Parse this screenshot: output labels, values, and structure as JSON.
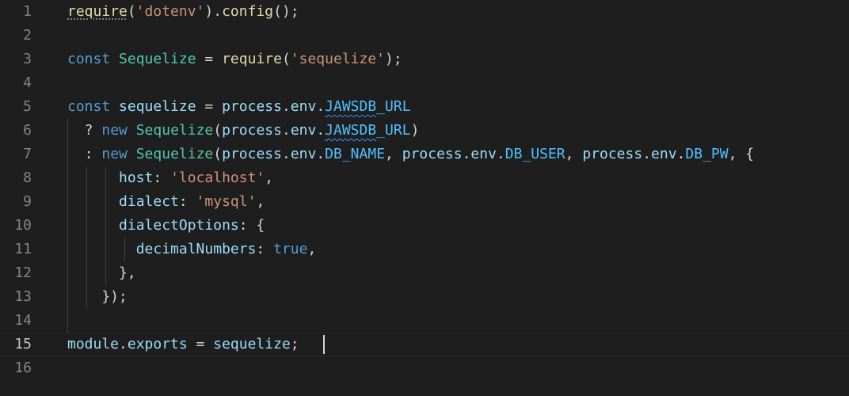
{
  "editor": {
    "lines": [
      {
        "number": "1",
        "tokens": [
          {
            "t": "require",
            "c": "fn",
            "deco": "dotted"
          },
          {
            "t": "(",
            "c": "plain"
          },
          {
            "t": "'dotenv'",
            "c": "str"
          },
          {
            "t": ").",
            "c": "plain"
          },
          {
            "t": "config",
            "c": "fn"
          },
          {
            "t": "();",
            "c": "plain"
          }
        ]
      },
      {
        "number": "2",
        "tokens": []
      },
      {
        "number": "3",
        "tokens": [
          {
            "t": "const ",
            "c": "kw"
          },
          {
            "t": "Sequelize",
            "c": "cls"
          },
          {
            "t": " = ",
            "c": "plain"
          },
          {
            "t": "require",
            "c": "fn"
          },
          {
            "t": "(",
            "c": "plain"
          },
          {
            "t": "'sequelize'",
            "c": "str"
          },
          {
            "t": ");",
            "c": "plain"
          }
        ]
      },
      {
        "number": "4",
        "tokens": []
      },
      {
        "number": "5",
        "tokens": [
          {
            "t": "const ",
            "c": "kw"
          },
          {
            "t": "sequelize",
            "c": "var"
          },
          {
            "t": " = ",
            "c": "plain"
          },
          {
            "t": "process",
            "c": "var"
          },
          {
            "t": ".",
            "c": "plain"
          },
          {
            "t": "env",
            "c": "var"
          },
          {
            "t": ".",
            "c": "plain"
          },
          {
            "t": "JAWSDB",
            "c": "const",
            "deco": "squiggle"
          },
          {
            "t": "_URL",
            "c": "const"
          }
        ]
      },
      {
        "number": "6",
        "tokens": [
          {
            "t": "  ? ",
            "c": "plain"
          },
          {
            "t": "new ",
            "c": "kw"
          },
          {
            "t": "Sequelize",
            "c": "cls"
          },
          {
            "t": "(",
            "c": "plain"
          },
          {
            "t": "process",
            "c": "var"
          },
          {
            "t": ".",
            "c": "plain"
          },
          {
            "t": "env",
            "c": "var"
          },
          {
            "t": ".",
            "c": "plain"
          },
          {
            "t": "JAWSDB",
            "c": "const",
            "deco": "squiggle"
          },
          {
            "t": "_URL",
            "c": "const"
          },
          {
            "t": ")",
            "c": "plain"
          }
        ]
      },
      {
        "number": "7",
        "tokens": [
          {
            "t": "  : ",
            "c": "plain"
          },
          {
            "t": "new ",
            "c": "kw"
          },
          {
            "t": "Sequelize",
            "c": "cls"
          },
          {
            "t": "(",
            "c": "plain"
          },
          {
            "t": "process",
            "c": "var"
          },
          {
            "t": ".",
            "c": "plain"
          },
          {
            "t": "env",
            "c": "var"
          },
          {
            "t": ".",
            "c": "plain"
          },
          {
            "t": "DB_NAME",
            "c": "const"
          },
          {
            "t": ", ",
            "c": "plain"
          },
          {
            "t": "process",
            "c": "var"
          },
          {
            "t": ".",
            "c": "plain"
          },
          {
            "t": "env",
            "c": "var"
          },
          {
            "t": ".",
            "c": "plain"
          },
          {
            "t": "DB_USER",
            "c": "const"
          },
          {
            "t": ", ",
            "c": "plain"
          },
          {
            "t": "process",
            "c": "var"
          },
          {
            "t": ".",
            "c": "plain"
          },
          {
            "t": "env",
            "c": "var"
          },
          {
            "t": ".",
            "c": "plain"
          },
          {
            "t": "DB_PW",
            "c": "const"
          },
          {
            "t": ", {",
            "c": "plain"
          }
        ]
      },
      {
        "number": "8",
        "tokens": [
          {
            "t": "      ",
            "c": "plain"
          },
          {
            "t": "host",
            "c": "var"
          },
          {
            "t": ": ",
            "c": "plain"
          },
          {
            "t": "'localhost'",
            "c": "str"
          },
          {
            "t": ",",
            "c": "plain"
          }
        ]
      },
      {
        "number": "9",
        "tokens": [
          {
            "t": "      ",
            "c": "plain"
          },
          {
            "t": "dialect",
            "c": "var"
          },
          {
            "t": ": ",
            "c": "plain"
          },
          {
            "t": "'mysql'",
            "c": "str"
          },
          {
            "t": ",",
            "c": "plain"
          }
        ]
      },
      {
        "number": "10",
        "tokens": [
          {
            "t": "      ",
            "c": "plain"
          },
          {
            "t": "dialectOptions",
            "c": "var"
          },
          {
            "t": ": {",
            "c": "plain"
          }
        ]
      },
      {
        "number": "11",
        "tokens": [
          {
            "t": "        ",
            "c": "plain"
          },
          {
            "t": "decimalNumbers",
            "c": "var"
          },
          {
            "t": ": ",
            "c": "plain"
          },
          {
            "t": "true",
            "c": "kw"
          },
          {
            "t": ",",
            "c": "plain"
          }
        ]
      },
      {
        "number": "12",
        "tokens": [
          {
            "t": "      },",
            "c": "plain"
          }
        ]
      },
      {
        "number": "13",
        "tokens": [
          {
            "t": "    });",
            "c": "plain"
          }
        ]
      },
      {
        "number": "14",
        "tokens": []
      },
      {
        "number": "15",
        "tokens": [
          {
            "t": "module",
            "c": "var"
          },
          {
            "t": ".",
            "c": "plain"
          },
          {
            "t": "exports",
            "c": "var"
          },
          {
            "t": " = ",
            "c": "plain"
          },
          {
            "t": "sequelize",
            "c": "var"
          },
          {
            "t": ";",
            "c": "plain"
          }
        ],
        "current": true
      },
      {
        "number": "16",
        "tokens": []
      }
    ]
  },
  "colors": {
    "background": "#1e1e1e",
    "keyword": "#569cd6",
    "function": "#dcdcaa",
    "string": "#ce9178",
    "class": "#4ec9b0",
    "variable": "#9cdcfe",
    "constant": "#4fc1ff",
    "text": "#d4d4d4",
    "line_number": "#858585"
  }
}
